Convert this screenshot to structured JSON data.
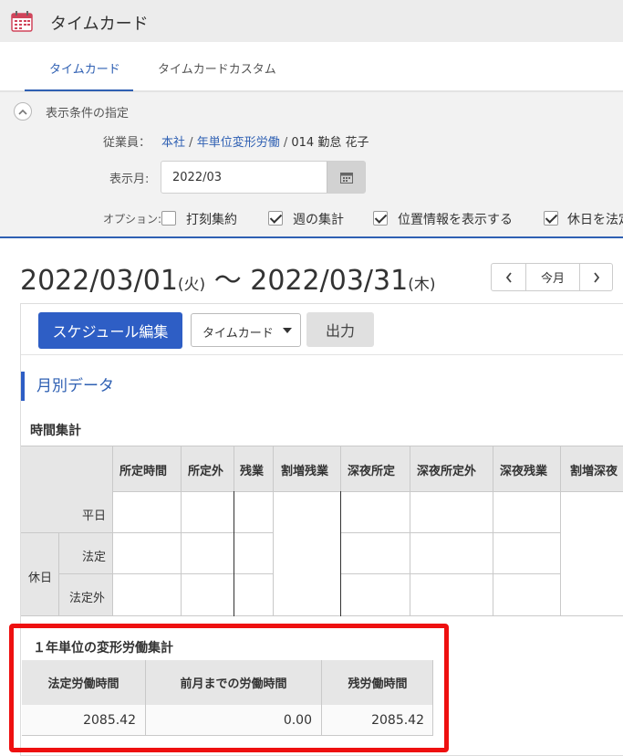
{
  "app": {
    "title": "タイムカード"
  },
  "tabs": [
    {
      "label": "タイムカード",
      "active": true
    },
    {
      "label": "タイムカードカスタム",
      "active": false
    }
  ],
  "filter": {
    "toggle_label": "表示条件の指定",
    "employee_label": "従業員：",
    "employee_path": {
      "company": "本社",
      "sep1": "/",
      "group": "年単位変形労働",
      "sep2": "/",
      "person": "014 勤怠 花子"
    },
    "month_label": "表示月:",
    "month_value": "2022/03",
    "options_label": "オプション:",
    "options": [
      {
        "label": "打刻集約",
        "checked": false
      },
      {
        "label": "週の集計",
        "checked": true
      },
      {
        "label": "位置情報を表示する",
        "checked": true
      },
      {
        "label": "休日を法定",
        "checked": true
      }
    ]
  },
  "range": {
    "start": "2022/03/01",
    "start_dow": "(火)",
    "sep": "〜",
    "end": "2022/03/31",
    "end_dow": "(木)"
  },
  "nav": {
    "today": "今月"
  },
  "toolbar": {
    "edit_schedule": "スケジュール編集",
    "view_select": "タイムカード",
    "output": "出力"
  },
  "monthly": {
    "section_title": "月別データ",
    "time_summary_title": "時間集計",
    "columns": [
      "所定時間",
      "所定外",
      "残業",
      "割増残業",
      "深夜所定",
      "深夜所定外",
      "深夜残業",
      "割増深夜"
    ],
    "rows": {
      "weekday": "平日",
      "holiday": "休日",
      "legal": "法定",
      "non_legal": "法定外"
    }
  },
  "annual": {
    "title": "１年単位の変形労働集計",
    "headers": [
      "法定労働時間",
      "前月までの労働時間",
      "残労働時間"
    ],
    "values": [
      "2085.42",
      "0.00",
      "2085.42"
    ]
  },
  "colors": {
    "accent": "#2f60b3",
    "primary_button": "#2e5ec5",
    "highlight": "#ee1010"
  }
}
